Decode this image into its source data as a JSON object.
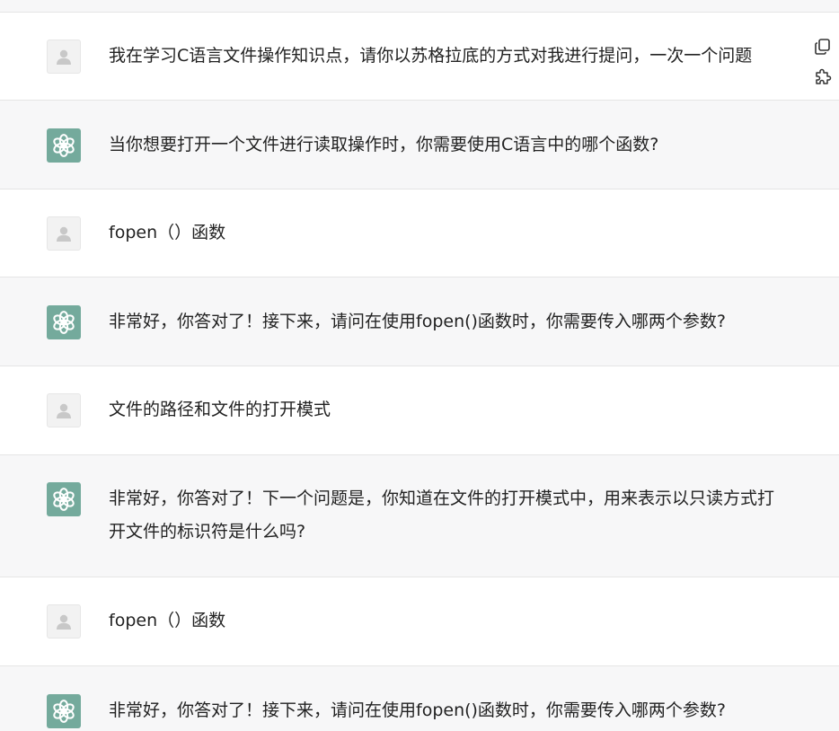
{
  "messages": [
    {
      "role": "user",
      "avatar_icon": "user-silhouette-icon",
      "text": "我在学习C语言文件操作知识点，请你以苏格拉底的方式对我进行提问，一次一个问题"
    },
    {
      "role": "assistant",
      "avatar_icon": "openai-logo-icon",
      "text": "当你想要打开一个文件进行读取操作时，你需要使用C语言中的哪个函数?"
    },
    {
      "role": "user",
      "avatar_icon": "user-silhouette-icon",
      "text": "fopen（）函数"
    },
    {
      "role": "assistant",
      "avatar_icon": "openai-logo-icon",
      "text": "非常好，你答对了！接下来，请问在使用fopen()函数时，你需要传入哪两个参数?"
    },
    {
      "role": "user",
      "avatar_icon": "user-silhouette-icon",
      "text": "文件的路径和文件的打开模式"
    },
    {
      "role": "assistant",
      "avatar_icon": "openai-logo-icon",
      "text": "非常好，你答对了！下一个问题是，你知道在文件的打开模式中，用来表示以只读方式打开文件的标识符是什么吗?"
    },
    {
      "role": "user",
      "avatar_icon": "user-silhouette-icon",
      "text": "fopen（）函数"
    },
    {
      "role": "assistant",
      "avatar_icon": "openai-logo-icon",
      "text": "非常好，你答对了！接下来，请问在使用fopen()函数时，你需要传入哪两个参数?"
    }
  ],
  "side_tools": [
    {
      "icon": "copy-icon"
    },
    {
      "icon": "puzzle-icon"
    }
  ],
  "colors": {
    "assistant_bg": "#f7f7f8",
    "user_bg": "#ffffff",
    "gpt_avatar_bg": "#74aa9c",
    "text": "#222222",
    "divider": "#e5e5e5"
  }
}
